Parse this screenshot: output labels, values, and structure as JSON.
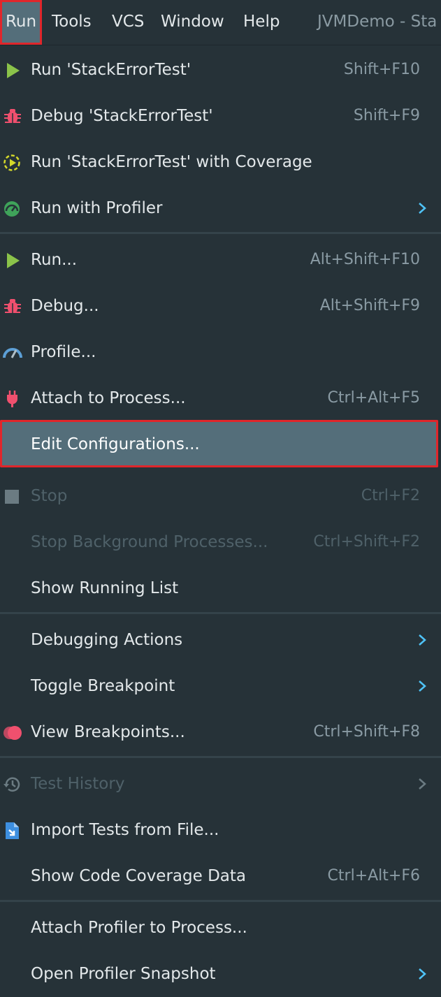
{
  "menubar": {
    "items": [
      "Run",
      "Tools",
      "VCS",
      "Window",
      "Help"
    ],
    "title": "JVMDemo - Sta"
  },
  "menu": {
    "items": [
      {
        "label": "Run 'StackErrorTest'",
        "shortcut": "Shift+F10",
        "icon": "run-icon"
      },
      {
        "label": "Debug 'StackErrorTest'",
        "shortcut": "Shift+F9",
        "icon": "debug-icon"
      },
      {
        "label": "Run 'StackErrorTest' with Coverage",
        "shortcut": "",
        "icon": "coverage-icon"
      },
      {
        "label": "Run with Profiler",
        "shortcut": "",
        "icon": "profiler-icon",
        "submenu": true
      },
      {
        "label": "Run...",
        "shortcut": "Alt+Shift+F10",
        "icon": "run-icon"
      },
      {
        "label": "Debug...",
        "shortcut": "Alt+Shift+F9",
        "icon": "debug-icon"
      },
      {
        "label": "Profile...",
        "shortcut": "",
        "icon": "profile-gauge-icon"
      },
      {
        "label": "Attach to Process...",
        "shortcut": "Ctrl+Alt+F5",
        "icon": "attach-plug-icon"
      },
      {
        "label": "Edit Configurations...",
        "shortcut": "",
        "selected": true
      },
      {
        "label": "Stop",
        "shortcut": "Ctrl+F2",
        "icon": "stop-icon",
        "disabled": true
      },
      {
        "label": "Stop Background Processes...",
        "shortcut": "Ctrl+Shift+F2",
        "disabled": true
      },
      {
        "label": "Show Running List",
        "shortcut": ""
      },
      {
        "label": "Debugging Actions",
        "shortcut": "",
        "submenu": true
      },
      {
        "label": "Toggle Breakpoint",
        "shortcut": "",
        "submenu": true
      },
      {
        "label": "View Breakpoints...",
        "shortcut": "Ctrl+Shift+F8",
        "icon": "breakpoints-icon"
      },
      {
        "label": "Test History",
        "shortcut": "",
        "icon": "history-icon",
        "disabled": true,
        "submenu": true
      },
      {
        "label": "Import Tests from File...",
        "shortcut": "",
        "icon": "import-file-icon"
      },
      {
        "label": "Show Code Coverage Data",
        "shortcut": "Ctrl+Alt+F6"
      },
      {
        "label": "Attach Profiler to Process...",
        "shortcut": ""
      },
      {
        "label": "Open Profiler Snapshot",
        "shortcut": "",
        "submenu": true
      }
    ]
  },
  "colors": {
    "background": "#263238",
    "selected": "#546e7a",
    "highlight_border": "#e0262b",
    "run_green": "#8bc34a",
    "debug_red": "#f0506e",
    "disabled_text": "#4f6169"
  }
}
